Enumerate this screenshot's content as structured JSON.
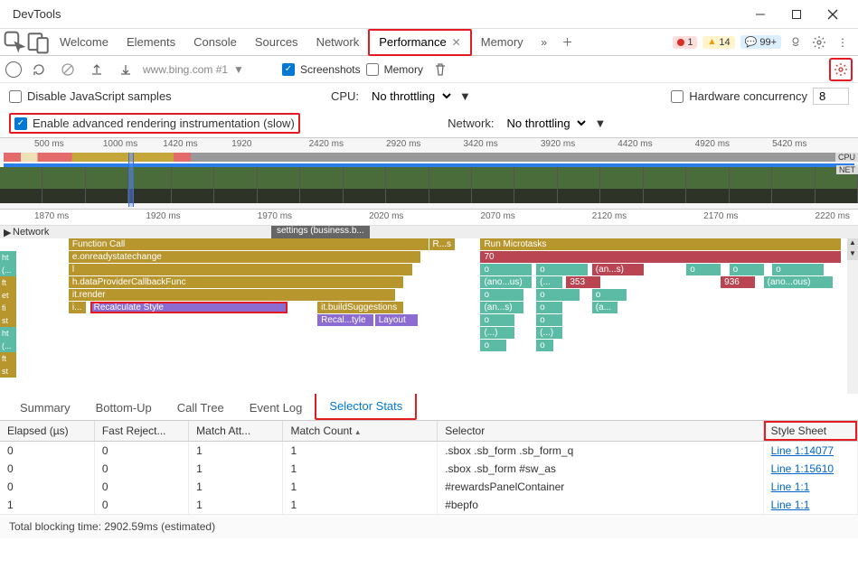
{
  "window": {
    "title": "DevTools"
  },
  "panel_tabs": {
    "welcome": "Welcome",
    "elements": "Elements",
    "console": "Console",
    "sources": "Sources",
    "network": "Network",
    "performance": "Performance",
    "memory": "Memory"
  },
  "badges": {
    "errors": "1",
    "warnings": "14",
    "info": "99+"
  },
  "perf_toolbar": {
    "url": "www.bing.com #1",
    "screenshots": "Screenshots",
    "memory": "Memory"
  },
  "settings": {
    "disable_js": "Disable JavaScript samples",
    "adv_rendering": "Enable advanced rendering instrumentation (slow)",
    "cpu_label": "CPU:",
    "cpu_value": "No throttling",
    "hw_conc_label": "Hardware concurrency",
    "hw_conc_value": "8",
    "net_label": "Network:",
    "net_value": "No throttling"
  },
  "overview_ticks": [
    "500 ms",
    "1000 ms",
    "1420 ms",
    "1920",
    "2420 ms",
    "2920 ms",
    "3420 ms",
    "3920 ms",
    "4420 ms",
    "4920 ms",
    "5420 ms"
  ],
  "overview_labels": {
    "cpu": "CPU",
    "net": "NET"
  },
  "detail_ticks": [
    "1870 ms",
    "1920 ms",
    "1970 ms",
    "2020 ms",
    "2070 ms",
    "2120 ms",
    "2170 ms",
    "2220 ms"
  ],
  "flame": {
    "network_label": "Network",
    "settings_badge": "settings (business.b...",
    "rows": {
      "r1": "Function Call",
      "r1b": "R...s",
      "r1c": "Run Microtasks",
      "r2": "e.onreadystatechange",
      "r2b": "70",
      "r3": "l",
      "r3b": "o",
      "r3c": "o",
      "r3d": "(an...s)",
      "r3e": "o",
      "r3f": "o",
      "r3g": "o",
      "r4": "h.dataProviderCallbackFunc",
      "r4b": "(ano...us)",
      "r4c": "(...",
      "r4d": "353",
      "r4e": "936",
      "r4f": "(ano...ous)",
      "r5": "it.render",
      "r5b": "o",
      "r5c": "o",
      "r5d": "o",
      "r6a": "i...",
      "r6": "Recalculate Style",
      "r6b": "it.buildSuggestions",
      "r6c": "(an...s)",
      "r6d": "o",
      "r6e": "(a...",
      "r7a": "Recal...tyle",
      "r7b": "Layout",
      "r7c": "o",
      "r7d": "o",
      "r8": "(...)",
      "r8b": "(...)",
      "r9": "o",
      "r9b": "o"
    }
  },
  "bottom_tabs": {
    "summary": "Summary",
    "bottom_up": "Bottom-Up",
    "call_tree": "Call Tree",
    "event_log": "Event Log",
    "selector_stats": "Selector Stats"
  },
  "table": {
    "headers": {
      "elapsed": "Elapsed (µs)",
      "fast_reject": "Fast Reject...",
      "match_att": "Match Att...",
      "match_count": "Match Count",
      "selector": "Selector",
      "stylesheet": "Style Sheet"
    },
    "rows": [
      {
        "elapsed": "0",
        "fr": "0",
        "ma": "1",
        "mc": "1",
        "sel": ".sbox .sb_form .sb_form_q",
        "ss": "Line 1:14077"
      },
      {
        "elapsed": "0",
        "fr": "0",
        "ma": "1",
        "mc": "1",
        "sel": ".sbox .sb_form #sw_as",
        "ss": "Line 1:15610"
      },
      {
        "elapsed": "0",
        "fr": "0",
        "ma": "1",
        "mc": "1",
        "sel": "#rewardsPanelContainer",
        "ss": "Line 1:1"
      },
      {
        "elapsed": "1",
        "fr": "0",
        "ma": "1",
        "mc": "1",
        "sel": "#bepfo",
        "ss": "Line 1:1"
      }
    ]
  },
  "footer": "Total blocking time: 2902.59ms (estimated)"
}
